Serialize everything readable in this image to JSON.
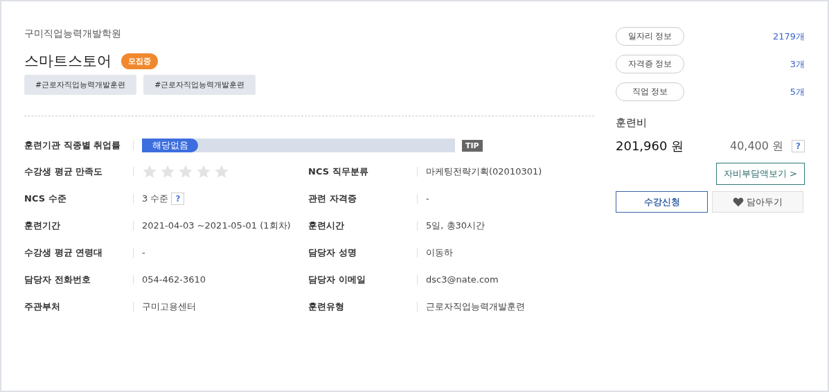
{
  "institution": "구미직업능력개발학원",
  "title": "스마트스토어",
  "status_badge": "모집중",
  "tags": [
    "#근로자직업능력개발훈련",
    "#근로자직업능력개발훈련"
  ],
  "employment_rate": {
    "label": "훈련기관 직종별 취업률",
    "value": "해당없음",
    "level": 0.18,
    "tip": "TIP"
  },
  "details": [
    {
      "left": {
        "label": "수강생 평균 만족도",
        "kind": "stars",
        "stars": 0
      },
      "right": {
        "label": "NCS 직무분류",
        "value": "마케팅전략기획(02010301)"
      }
    },
    {
      "left": {
        "label": "NCS 수준",
        "kind": "help",
        "value": "3 수준",
        "help": "?"
      },
      "right": {
        "label": "관련 자격증",
        "value": "-"
      }
    },
    {
      "left": {
        "label": "훈련기간",
        "kind": "text",
        "value": "2021-04-03 ~2021-05-01 (1회차)"
      },
      "right": {
        "label": "훈련시간",
        "value": "5일, 총30시간"
      }
    },
    {
      "left": {
        "label": "수강생 평균 연령대",
        "kind": "text",
        "value": "-"
      },
      "right": {
        "label": "담당자 성명",
        "value": "이동하"
      }
    },
    {
      "left": {
        "label": "담당자 전화번호",
        "kind": "text",
        "value": "054-462-3610"
      },
      "right": {
        "label": "담당자 이메일",
        "value": "dsc3@nate.com"
      }
    },
    {
      "left": {
        "label": "주관부처",
        "kind": "text",
        "value": "구미고용센터"
      },
      "right": {
        "label": "훈련유형",
        "value": "근로자직업능력개발훈련"
      }
    }
  ],
  "info_links": [
    {
      "label": "일자리 정보",
      "count": "2179개"
    },
    {
      "label": "자격증 정보",
      "count": "3개"
    },
    {
      "label": "직업 정보",
      "count": "5개"
    }
  ],
  "fee": {
    "label": "훈련비",
    "amount": "201,960 원",
    "self_pay": "40,400 원",
    "help": "?"
  },
  "self_pay_button": "자비부담액보기 >",
  "apply_button": "수강신청",
  "save_button": "담아두기"
}
